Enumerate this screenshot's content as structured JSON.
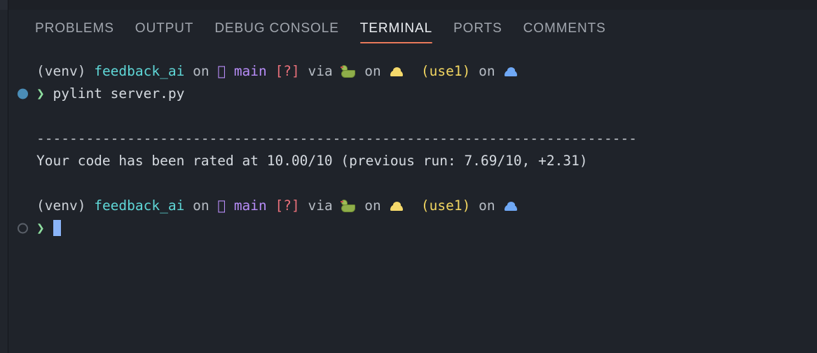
{
  "window": {
    "panel": "terminal-panel",
    "background": "#1f232a"
  },
  "tabs": {
    "items": [
      {
        "label": "PROBLEMS",
        "active": false
      },
      {
        "label": "OUTPUT",
        "active": false
      },
      {
        "label": "DEBUG CONSOLE",
        "active": false
      },
      {
        "label": "TERMINAL",
        "active": true
      },
      {
        "label": "PORTS",
        "active": false
      },
      {
        "label": "COMMENTS",
        "active": false
      }
    ],
    "active_label": "TERMINAL",
    "active_underline_color": "#e8795a",
    "inactive_color": "#a1a6ae",
    "active_color": "#eceff3"
  },
  "terminal": {
    "prompt_1": {
      "venv": "(venv)",
      "repo": "feedback_ai",
      "on_1": " on ",
      "branch_icon": "git-branch-icon",
      "branch": "main",
      "dirty_marker": "[?]",
      "via": " via ",
      "python_icon": "snake-emoji",
      "on_2": " on ",
      "aws_icon": "aws-cloud-icon",
      "context": "(use1)",
      "on_3": " on ",
      "azure_icon": "azure-cloud-icon"
    },
    "command_line": {
      "decoration": "command-success",
      "chevron": "❯",
      "command": "pylint server.py"
    },
    "output": {
      "separator": "-------------------------------------------------------------------------",
      "rating_message": "Your code has been rated at 10.00/10 (previous run: 7.69/10, +2.31)"
    },
    "prompt_2": {
      "venv": "(venv)",
      "repo": "feedback_ai",
      "on_1": " on ",
      "branch_icon": "git-branch-icon",
      "branch": "main",
      "dirty_marker": "[?]",
      "via": " via ",
      "python_icon": "snake-emoji",
      "on_2": " on ",
      "aws_icon": "aws-cloud-icon",
      "context": "(use1)",
      "on_3": " on ",
      "azure_icon": "azure-cloud-icon"
    },
    "input_line": {
      "decoration": "command-pending",
      "chevron": "❯",
      "value": "",
      "cursor": "block-cursor"
    },
    "colors": {
      "repo": "#5fd7d7",
      "branch": "#b78cf7",
      "dirty": "#e8707a",
      "context": "#f2d661",
      "chevron": "#8fdfa0",
      "text": "#cdd2d8",
      "cursor": "#8ab4f8",
      "success_dot": "#4a8db7",
      "idle_dot": "#5a6069"
    }
  }
}
